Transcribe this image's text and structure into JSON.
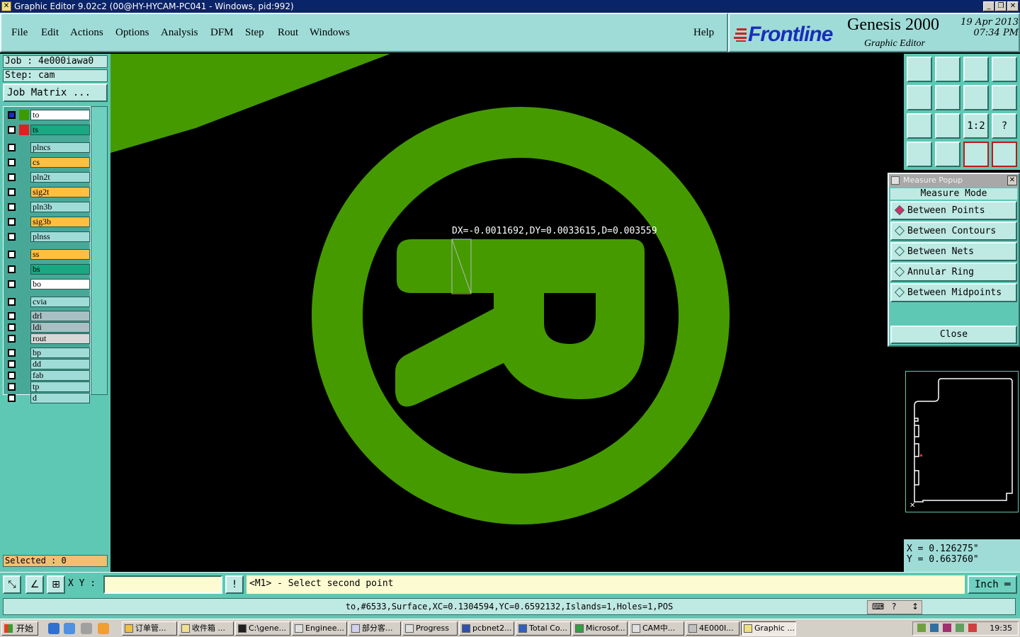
{
  "window": {
    "title": "Graphic Editor 9.02c2 (00@HY-HYCAM-PC041 - Windows, pid:992)",
    "app_icon": "x-app-icon",
    "controls": [
      "_",
      "❐",
      "✕"
    ]
  },
  "menu": {
    "items": [
      "File",
      "Edit",
      "Actions",
      "Options",
      "Analysis",
      "DFM",
      "Step",
      "Rout",
      "Windows"
    ],
    "help": "Help"
  },
  "brand": {
    "logo": "Frontline",
    "product": "Genesis 2000",
    "subtitle": "Graphic Editor",
    "date": "19 Apr 2013",
    "time": "07:34 PM"
  },
  "job": {
    "job_line": "Job : 4e000iawa0",
    "step_line": "Step: cam",
    "matrix_button": "Job Matrix ..."
  },
  "layers": [
    {
      "name": "to",
      "color": "#ffffff",
      "swatch": "#3d9a00",
      "checked": true
    },
    {
      "name": "ts",
      "color": "#1aa882",
      "swatch": "#e02020",
      "checked": false
    },
    {
      "name": "plncs",
      "color": "#9fdcd8",
      "swatch": "",
      "checked": false
    },
    {
      "name": "cs",
      "color": "#ffc040",
      "swatch": "",
      "checked": false
    },
    {
      "name": "pln2t",
      "color": "#9fdcd8",
      "swatch": "",
      "checked": false
    },
    {
      "name": "sig2t",
      "color": "#ffc040",
      "swatch": "",
      "checked": false
    },
    {
      "name": "pln3b",
      "color": "#9fdcd8",
      "swatch": "",
      "checked": false
    },
    {
      "name": "sig3b",
      "color": "#ffc040",
      "swatch": "",
      "checked": false
    },
    {
      "name": "plnss",
      "color": "#9fdcd8",
      "swatch": "",
      "checked": false
    },
    {
      "name": "ss",
      "color": "#ffc040",
      "swatch": "",
      "checked": false
    },
    {
      "name": "bs",
      "color": "#1aa882",
      "swatch": "",
      "checked": false
    },
    {
      "name": "bo",
      "color": "#ffffff",
      "swatch": "",
      "checked": false
    },
    {
      "name": "cvia",
      "color": "#9fdcd8",
      "swatch": "",
      "checked": false
    },
    {
      "name": "drl",
      "color": "#a8c0c4",
      "swatch": "",
      "checked": false
    },
    {
      "name": "ldi",
      "color": "#a8c0c4",
      "swatch": "",
      "checked": false
    },
    {
      "name": "rout",
      "color": "#d8d8d8",
      "swatch": "",
      "checked": false
    },
    {
      "name": "bp",
      "color": "#9fdcd8",
      "swatch": "",
      "checked": false
    },
    {
      "name": "dd",
      "color": "#9fdcd8",
      "swatch": "",
      "checked": false
    },
    {
      "name": "fab",
      "color": "#9fdcd8",
      "swatch": "",
      "checked": false
    },
    {
      "name": "tp",
      "color": "#9fdcd8",
      "swatch": "",
      "checked": false
    },
    {
      "name": "d",
      "color": "#9fdcd8",
      "swatch": "",
      "checked": false
    }
  ],
  "selected_text": "Selected : 0",
  "canvas": {
    "feature_color": "#459a00",
    "measure_readout": "DX=-0.0011692,DY=0.0033615,D=0.003559"
  },
  "toolbar_icons": [
    "zoom-prev-icon",
    "zoom-next-icon",
    "home-icon",
    "split-view-icon",
    "pan-left-icon",
    "pan-right-icon",
    "undo-view-icon",
    "redraw-icon",
    "zoom-fit-icon",
    "zoom-center-icon",
    "scale-1-2-icon",
    "help-query-icon",
    "tools-icon",
    "snap-icon",
    "layers-red-icon",
    "layers-config-icon"
  ],
  "toolbar_labels": [
    "",
    "",
    "",
    "",
    "",
    "",
    "",
    "",
    "",
    "",
    "1:2",
    "?",
    "",
    "",
    "",
    ""
  ],
  "measure_popup": {
    "title": "Measure Popup",
    "mode_heading": "Measure Mode",
    "options": [
      {
        "label": "Between Points",
        "selected": true
      },
      {
        "label": "Between Contours",
        "selected": false
      },
      {
        "label": "Between Nets",
        "selected": false
      },
      {
        "label": "Annular Ring",
        "selected": false
      },
      {
        "label": "Between Midpoints",
        "selected": false
      }
    ],
    "close_label": "Close"
  },
  "coords": {
    "x": "X = 0.126275\"",
    "y": "Y = 0.663760\""
  },
  "command": {
    "xy_label": "X Y :",
    "xy_value": "",
    "prompt": "<M1> - Select second point",
    "unit": "Inch"
  },
  "status": {
    "text": "to,#6533,Surface,XC=0.1304594,YC=0.6592132,Islands=1,Holes=1,POS"
  },
  "taskbar": {
    "start": "开始",
    "tasks": [
      {
        "label": "订单管...",
        "active": false
      },
      {
        "label": "收件箱 ...",
        "active": false
      },
      {
        "label": "C:\\gene...",
        "active": false
      },
      {
        "label": "Enginee...",
        "active": false
      },
      {
        "label": "部分客...",
        "active": false
      },
      {
        "label": "Progress",
        "active": false
      },
      {
        "label": "pcbnet2...",
        "active": false
      },
      {
        "label": "Total Co...",
        "active": false
      },
      {
        "label": "Microsof...",
        "active": false
      },
      {
        "label": "CAM中...",
        "active": false
      },
      {
        "label": "4E000I...",
        "active": false
      },
      {
        "label": "Graphic ...",
        "active": true
      }
    ],
    "clock": "19:35"
  }
}
